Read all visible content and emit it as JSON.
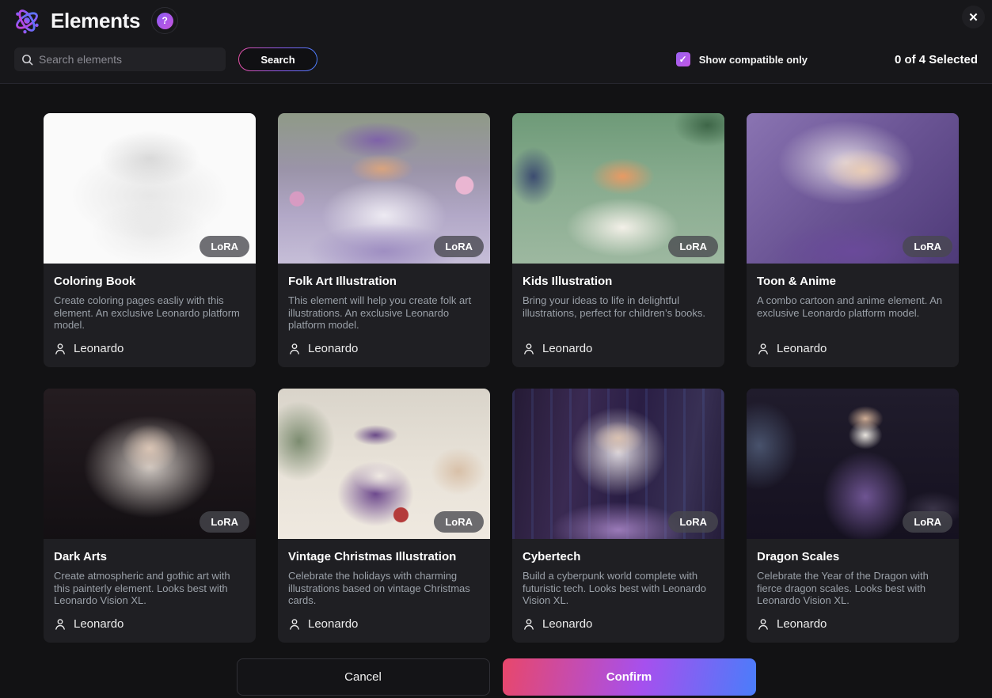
{
  "header": {
    "title": "Elements",
    "help_glyph": "?",
    "close_glyph": "✕",
    "search": {
      "placeholder": "Search elements",
      "button_label": "Search"
    },
    "compatible": {
      "label": "Show compatible only",
      "checked_glyph": "✓"
    },
    "selected_count": "0 of 4 Selected"
  },
  "cards": [
    {
      "title": "Coloring Book",
      "badge": "LoRA",
      "author": "Leonardo",
      "description": "Create coloring pages easliy with this element. An exclusive Leonardo platform model."
    },
    {
      "title": "Folk Art Illustration",
      "badge": "LoRA",
      "author": "Leonardo",
      "description": "This element will help you create folk art illustrations. An exclusive Leonardo platform model."
    },
    {
      "title": "Kids Illustration",
      "badge": "LoRA",
      "author": "Leonardo",
      "description": "Bring your ideas to life in delightful illustrations, perfect for children’s books."
    },
    {
      "title": "Toon & Anime",
      "badge": "LoRA",
      "author": "Leonardo",
      "description": "A combo cartoon and anime element. An exclusive Leonardo platform model."
    },
    {
      "title": "Dark Arts",
      "badge": "LoRA",
      "author": "Leonardo",
      "description": "Create atmospheric and gothic art with this painterly element. Looks best with Leonardo Vision XL."
    },
    {
      "title": "Vintage Christmas Illustration",
      "badge": "LoRA",
      "author": "Leonardo",
      "description": "Celebrate the holidays with charming illustrations based on vintage Christmas cards."
    },
    {
      "title": "Cybertech",
      "badge": "LoRA",
      "author": "Leonardo",
      "description": "Build a cyberpunk world complete with futuristic tech. Looks best with Leonardo Vision XL."
    },
    {
      "title": "Dragon Scales",
      "badge": "LoRA",
      "author": "Leonardo",
      "description": "Celebrate the Year of the Dragon with fierce dragon scales. Looks best with Leonardo Vision XL."
    }
  ],
  "footer": {
    "cancel_label": "Cancel",
    "confirm_label": "Confirm"
  },
  "colors": {
    "background": "#121214",
    "card_background": "#1f1f23",
    "accent_gradient_start": "#e8476b",
    "accent_gradient_mid": "#a650ee",
    "accent_gradient_end": "#4a7dfa",
    "checkbox_gradient_start": "#9a62f2",
    "checkbox_gradient_end": "#c257e4",
    "muted_text": "#9aa0a8"
  }
}
